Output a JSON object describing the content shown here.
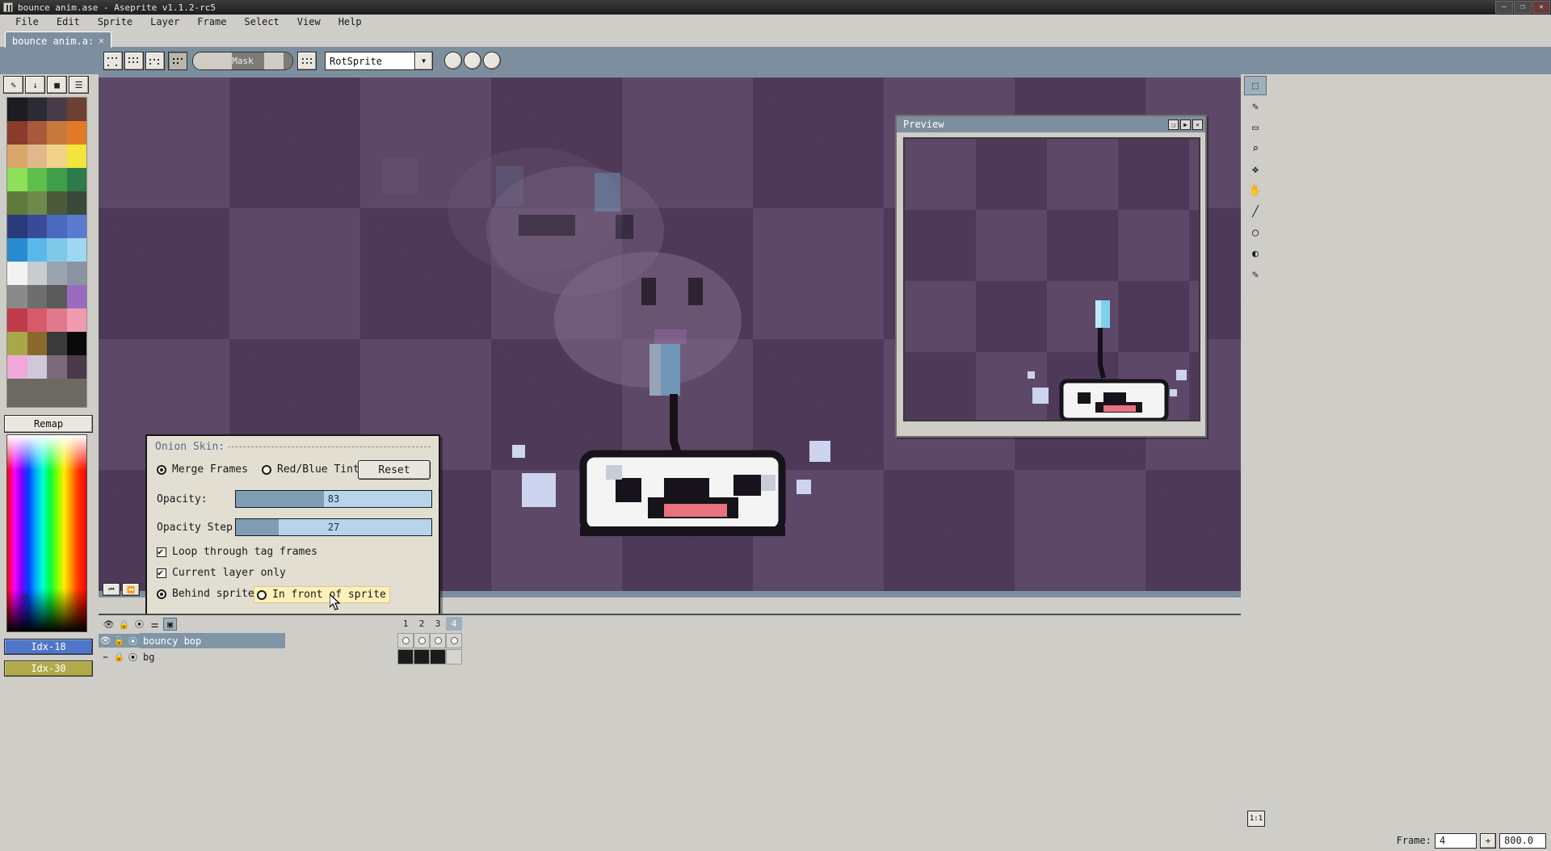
{
  "window": {
    "title": "bounce anim.ase - Aseprite v1.1.2-rc5",
    "minimize": "–",
    "maximize": "❐",
    "close": "✕"
  },
  "menubar": [
    {
      "label": "File"
    },
    {
      "label": "Edit"
    },
    {
      "label": "Sprite"
    },
    {
      "label": "Layer"
    },
    {
      "label": "Frame"
    },
    {
      "label": "Select"
    },
    {
      "label": "View"
    },
    {
      "label": "Help"
    }
  ],
  "tab": {
    "label": "bounce anim.a:",
    "close": "✕"
  },
  "toolbar": {
    "mask_label": "Mask",
    "rotation_algorithm": "RotSprite",
    "dropdown_arrow": "▼"
  },
  "left_panel": {
    "remap_label": "Remap",
    "index_a": "Idx-18",
    "index_b": "Idx-30",
    "palette_colors": [
      "#1c1c22",
      "#2b2b33",
      "#4a3a4a",
      "#6e4034",
      "#8a3b2c",
      "#a85a3c",
      "#c77a3c",
      "#e07a28",
      "#d9a76a",
      "#e0b88c",
      "#f0d28a",
      "#f2e63c",
      "#8ce05a",
      "#5ec04a",
      "#3f9e4a",
      "#2f7a4a",
      "#5f7a3a",
      "#6e8a4a",
      "#4a5a3a",
      "#3a4a3a",
      "#2a3a7a",
      "#3a4a9a",
      "#4a6ac0",
      "#5a7ad0",
      "#2a8ad0",
      "#5ab8e8",
      "#7ec8e8",
      "#9ed8f0",
      "#f2f2f2",
      "#c8ccd0",
      "#9aa4ae",
      "#8a94a0",
      "#8a8a8a",
      "#6e6e6e",
      "#5a5a5a",
      "#9a6ac0",
      "#c03a4a",
      "#d85a6a",
      "#e07a8a",
      "#f09ab0",
      "#a8a84a",
      "#8a6a2a",
      "#3a3a3a",
      "#0a0a0a",
      "#f0a8d8",
      "#d0c8d8",
      "#7a6a7a",
      "#4a3a4a"
    ]
  },
  "preview": {
    "title": "Preview",
    "btn_fit": "❑",
    "btn_play": "▶",
    "btn_close": "✕"
  },
  "onion_skin": {
    "legend": "Onion Skin:",
    "merge_frames": {
      "label": "Merge Frames",
      "selected": true
    },
    "red_blue_tint": {
      "label": "Red/Blue Tint",
      "selected": false
    },
    "reset_label": "Reset",
    "opacity": {
      "label": "Opacity:",
      "value": "83",
      "percent": 45
    },
    "opacity_step": {
      "label": "Opacity Step:",
      "value": "27",
      "percent": 22
    },
    "loop_through_tag_frames": {
      "label": "Loop through tag frames",
      "checked": true
    },
    "current_layer_only": {
      "label": "Current layer only",
      "checked": true
    },
    "behind_sprite": {
      "label": "Behind sprite",
      "selected": true
    },
    "in_front_of_sprite": {
      "label": "In front of sprite",
      "selected": false,
      "hovered": true
    }
  },
  "timeline": {
    "header_icons": [
      "eye-icon",
      "lock-icon",
      "continuous-icon",
      "tag-icon",
      "onion-icon"
    ],
    "frames": [
      "1",
      "2",
      "3",
      "4"
    ],
    "active_frame": "4",
    "layers": [
      {
        "name": "bouncy bop",
        "selected": true,
        "visible": true,
        "locked": true,
        "continuous": true,
        "cels": [
          "empty",
          "empty",
          "empty",
          "empty"
        ]
      },
      {
        "name": "bg",
        "selected": false,
        "visible": false,
        "locked": true,
        "continuous": true,
        "cels": [
          "filled",
          "filled",
          "filled",
          "empty"
        ]
      }
    ],
    "nav_first": "⏮",
    "nav_prev": "⏪"
  },
  "statusbar": {
    "frame_label": "Frame:",
    "frame_value": "4",
    "add_frame": "+",
    "duration_value": "800.0",
    "zoom_chip": "1:1"
  },
  "right_tools": [
    {
      "name": "marquee-icon",
      "glyph": "⬚"
    },
    {
      "name": "pencil-icon",
      "glyph": "✎"
    },
    {
      "name": "eraser-icon",
      "glyph": "▭"
    },
    {
      "name": "zoom-icon",
      "glyph": "⌕"
    },
    {
      "name": "move-icon",
      "glyph": "✥"
    },
    {
      "name": "hand-icon",
      "glyph": "✋"
    },
    {
      "name": "line-icon",
      "glyph": "╱"
    },
    {
      "name": "ellipse-icon",
      "glyph": "◯"
    },
    {
      "name": "gradient-icon",
      "glyph": "◐"
    },
    {
      "name": "eyedropper-icon",
      "glyph": "✒"
    }
  ]
}
